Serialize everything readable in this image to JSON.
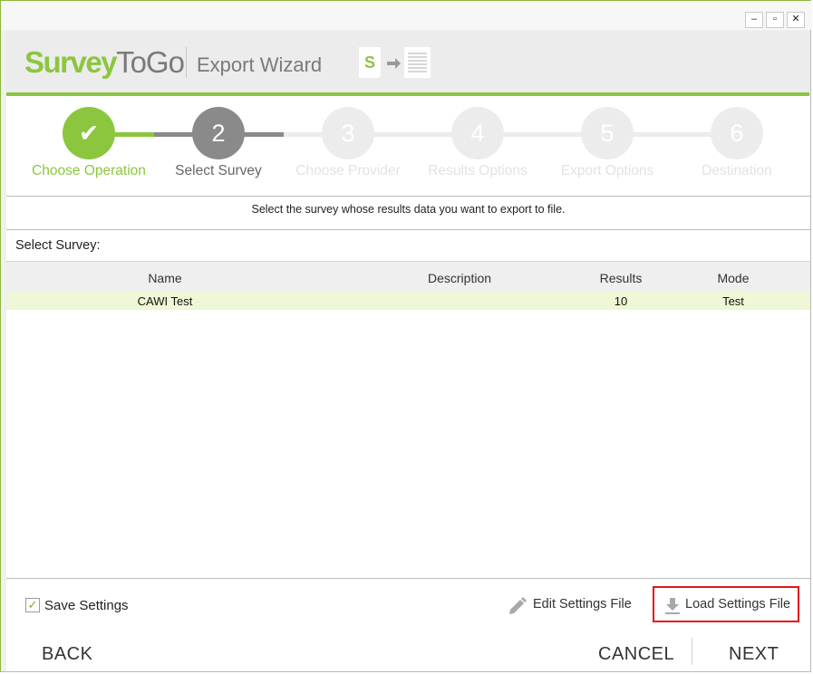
{
  "window": {
    "minimize": "–",
    "maximize": "▫",
    "close": "✕"
  },
  "header": {
    "logo_survey": "Survey",
    "logo_togo": "ToGo",
    "subtitle": "Export Wizard"
  },
  "steps": [
    {
      "number": "✔",
      "label": "Choose Operation",
      "state": "done"
    },
    {
      "number": "2",
      "label": "Select Survey",
      "state": "current"
    },
    {
      "number": "3",
      "label": "Choose Provider",
      "state": "pending"
    },
    {
      "number": "4",
      "label": "Results Options",
      "state": "pending"
    },
    {
      "number": "5",
      "label": "Export Options",
      "state": "pending"
    },
    {
      "number": "6",
      "label": "Destination",
      "state": "pending"
    }
  ],
  "colors": {
    "accent_green": "#8cc63f",
    "current_gray": "#8a8a8a",
    "pending_gray": "#ececec",
    "row_highlight": "#eef7d6",
    "highlight_red": "#e3141a"
  },
  "instruction": "Select the survey whose results data you want to export to file.",
  "select_label": "Select Survey:",
  "table": {
    "columns": [
      "Name",
      "Description",
      "Results",
      "Mode"
    ],
    "rows": [
      {
        "name": "CAWI Test",
        "description": "",
        "results": "10",
        "mode": "Test"
      }
    ]
  },
  "footer": {
    "save_settings": "Save Settings",
    "save_checked": true,
    "edit_settings": "Edit Settings File",
    "load_settings": "Load Settings File",
    "back": "BACK",
    "cancel": "CANCEL",
    "next": "NEXT"
  },
  "icons": {
    "edit": "pencil-icon",
    "load": "download-icon",
    "header": "survey-to-document-icon"
  }
}
